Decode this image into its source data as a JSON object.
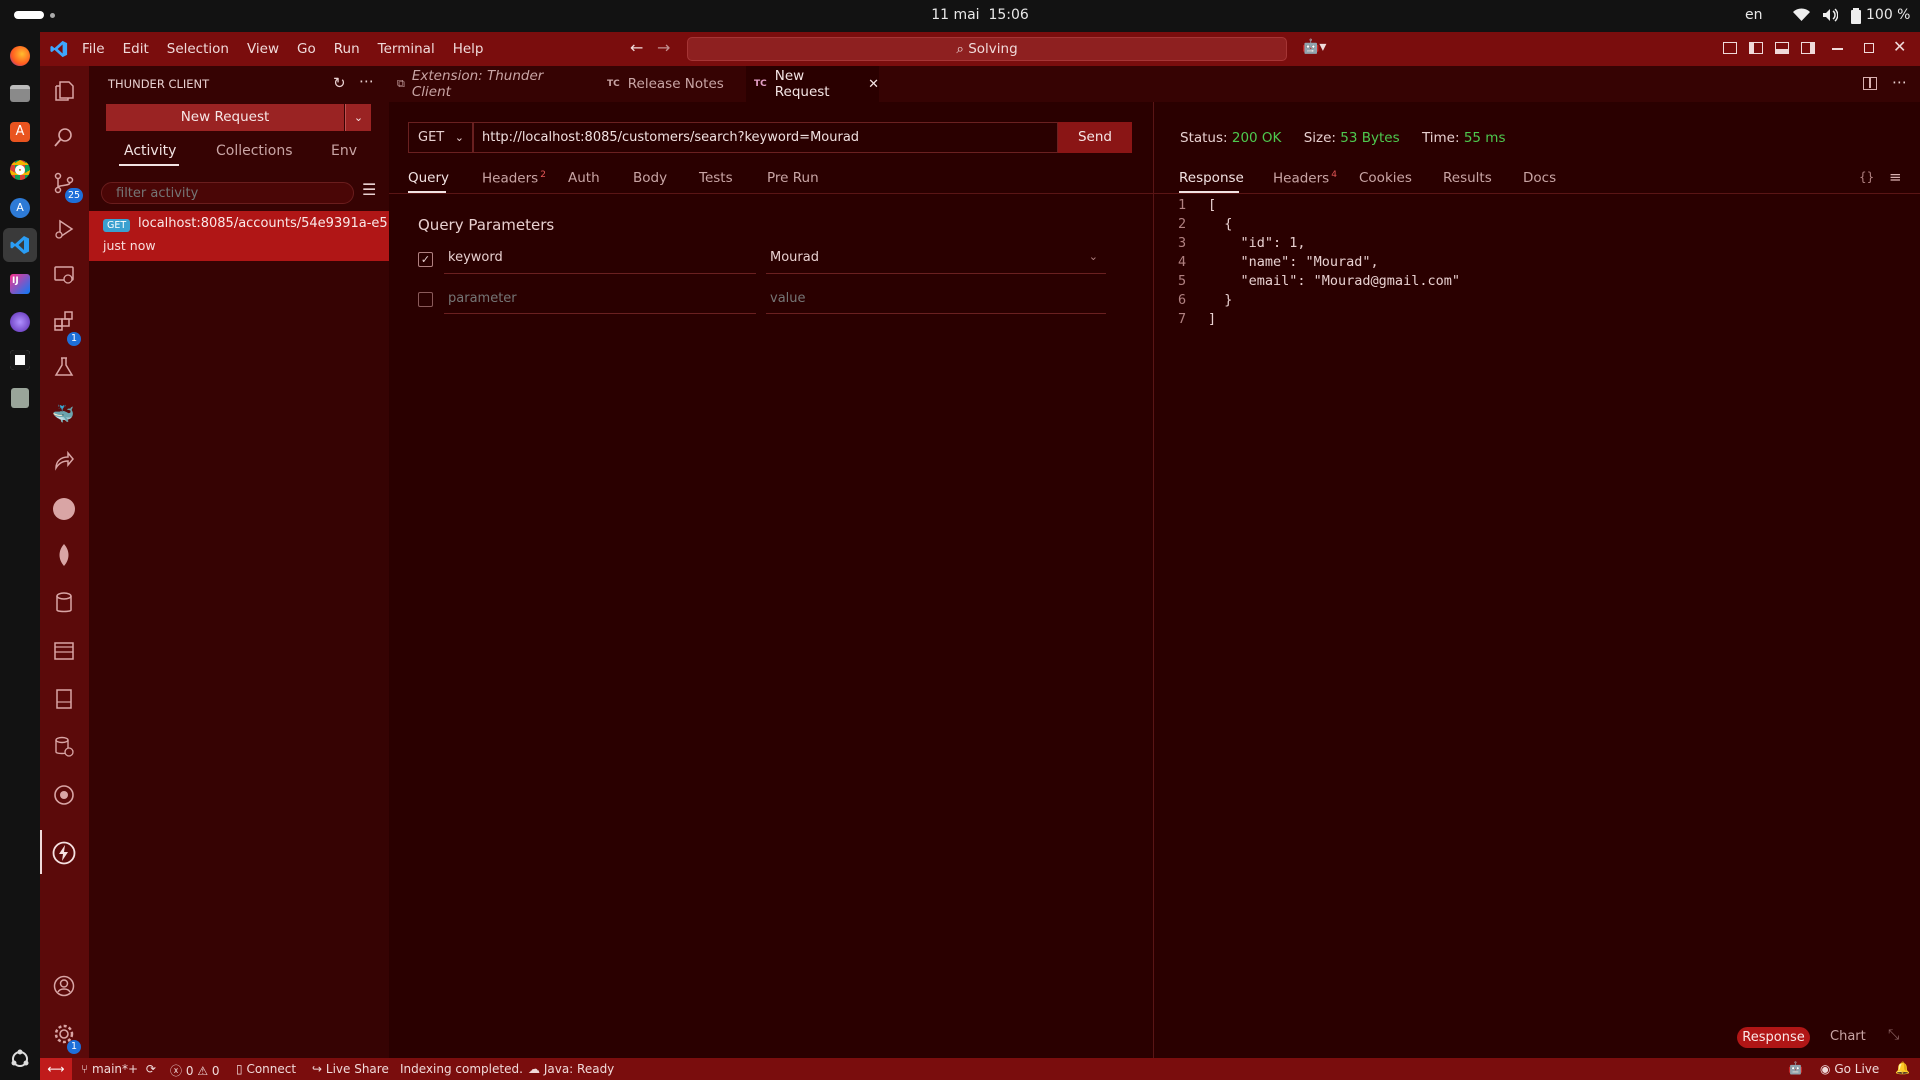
{
  "topbar": {
    "datetime": "11 mai  15:06",
    "lang": "en",
    "battery": "100 %"
  },
  "titlebar": {
    "menu": [
      "File",
      "Edit",
      "Selection",
      "View",
      "Go",
      "Run",
      "Terminal",
      "Help"
    ],
    "search_text": "Solving"
  },
  "activity_badges": {
    "source_control": "25",
    "extensions": "1",
    "settings": "1"
  },
  "sidebar": {
    "title": "THUNDER CLIENT",
    "new_request_label": "New Request",
    "tabs": [
      "Activity",
      "Collections",
      "Env"
    ],
    "filter_placeholder": "filter activity",
    "activity_item": {
      "method": "GET",
      "url": "localhost:8085/accounts/54e9391a-e5...",
      "time": "just now"
    }
  },
  "editor_tabs": [
    {
      "label": "Extension: Thunder Client"
    },
    {
      "prefix": "TC",
      "label": "Release Notes"
    },
    {
      "prefix": "TC",
      "label": "New Request"
    }
  ],
  "request": {
    "method": "GET",
    "url": "http://localhost:8085/customers/search?keyword=Mourad",
    "send_label": "Send",
    "tabs": [
      "Query",
      "Headers",
      "Auth",
      "Body",
      "Tests",
      "Pre Run"
    ],
    "headers_count": "2",
    "section_title": "Query Parameters",
    "params": [
      {
        "key": "keyword",
        "value": "Mourad",
        "checked": true
      }
    ],
    "param_placeholder": "parameter",
    "value_placeholder": "value"
  },
  "response": {
    "status_label": "Status:",
    "status_value": "200 OK",
    "size_label": "Size:",
    "size_value": "53 Bytes",
    "time_label": "Time:",
    "time_value": "55 ms",
    "tabs": [
      "Response",
      "Headers",
      "Cookies",
      "Results",
      "Docs"
    ],
    "headers_count": "4",
    "json_brace_icon": "{}",
    "lines": [
      "[",
      "  {",
      "    \"id\": 1,",
      "    \"name\": \"Mourad\",",
      "    \"email\": \"Mourad@gmail.com\"",
      "  }",
      "]"
    ],
    "footer_tabs": [
      "Response",
      "Chart"
    ]
  },
  "statusbar": {
    "branch": "main*+",
    "errors": "0",
    "warnings": "0",
    "connect": "Connect",
    "liveshare": "Live Share",
    "indexing": "Indexing completed.",
    "java": "Java: Ready",
    "golive": "Go Live"
  },
  "colors": {
    "accent": "#7a0d0d",
    "green": "#4ec94e",
    "badge_blue": "#1e6fd9",
    "send": "#8a1515"
  }
}
